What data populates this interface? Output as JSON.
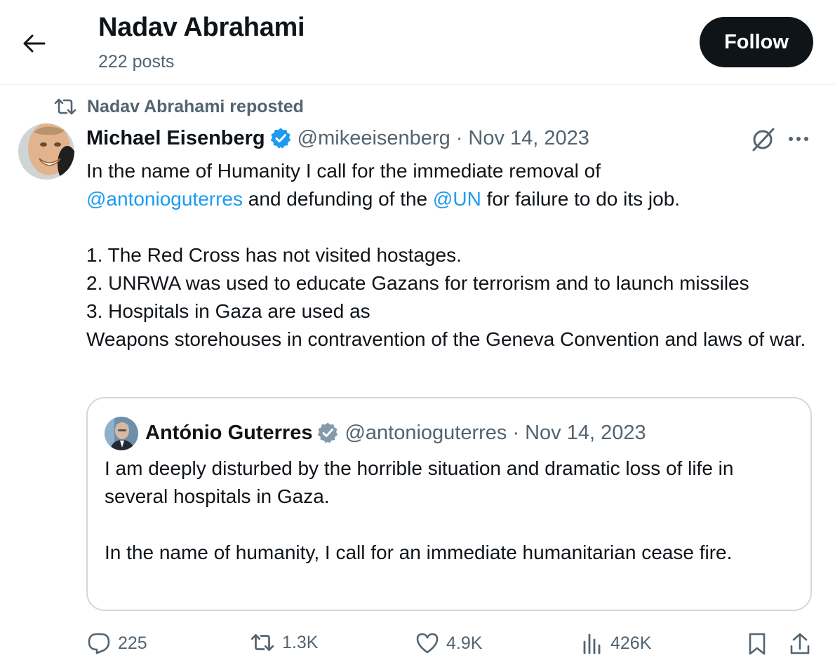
{
  "header": {
    "profile_name": "Nadav Abrahami",
    "post_count": "222 posts",
    "follow_label": "Follow"
  },
  "repost": {
    "text": "Nadav Abrahami reposted"
  },
  "tweet": {
    "author_name": "Michael Eisenberg",
    "handle": "@mikeeisenberg",
    "separator": "·",
    "date": "Nov 14, 2023",
    "text_part1": "In the name of Humanity I call for the immediate removal of\n",
    "mention1": "@antonioguterres",
    "text_part2": " and defunding of the ",
    "mention2": "@UN",
    "text_part3": " for failure to do its job.\n\n1. The Red Cross has not visited hostages.\n2. UNRWA was used to educate Gazans for terrorism and to launch missiles\n3. Hospitals in Gaza are used as\nWeapons storehouses in contravention of the Geneva Convention and laws of war."
  },
  "quote": {
    "author_name": "António Guterres",
    "handle": "@antonioguterres",
    "separator": "·",
    "date": "Nov 14, 2023",
    "text": "I am deeply disturbed by the horrible situation and dramatic loss of life in several hospitals in Gaza.\n\nIn the name of humanity, I call for an immediate humanitarian cease fire."
  },
  "actions": {
    "replies": "225",
    "reposts": "1.3K",
    "likes": "4.9K",
    "views": "426K"
  },
  "icons": {
    "back": "arrow-left-icon",
    "repost": "repost-icon",
    "verified": "verified-badge-icon",
    "grok": "grok-icon",
    "more": "more-icon",
    "reply": "reply-icon",
    "like": "heart-icon",
    "views": "views-icon",
    "bookmark": "bookmark-icon",
    "share": "share-icon"
  },
  "colors": {
    "link": "#1d9bf0",
    "muted": "#536471",
    "text": "#0f1419",
    "border": "#cfd9de",
    "follow_bg": "#0f1419"
  }
}
